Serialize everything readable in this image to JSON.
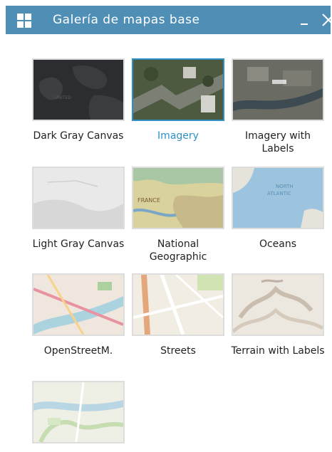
{
  "window": {
    "title": "Galería de mapas base",
    "minimize_icon": "minimize-icon",
    "close_icon": "close-icon",
    "app_icon": "grid-icon",
    "header_color": "#4f8fb5"
  },
  "gallery": {
    "selected_color": "#2e8fc7",
    "items": [
      {
        "label": "Dark Gray Canvas",
        "selected": false
      },
      {
        "label": "Imagery",
        "selected": true
      },
      {
        "label": "Imagery with Labels",
        "selected": false
      },
      {
        "label": "Light Gray Canvas",
        "selected": false
      },
      {
        "label": "National Geographic",
        "selected": false
      },
      {
        "label": "Oceans",
        "selected": false
      },
      {
        "label": "OpenStreetM.",
        "selected": false
      },
      {
        "label": "Streets",
        "selected": false
      },
      {
        "label": "Terrain with Labels",
        "selected": false
      },
      {
        "label": "",
        "selected": false
      }
    ]
  }
}
